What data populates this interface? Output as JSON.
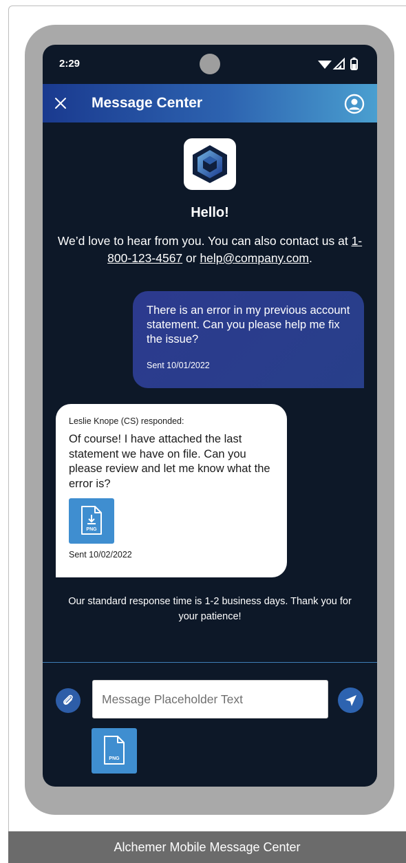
{
  "status_bar": {
    "time": "2:29",
    "icons": [
      "wifi-icon",
      "signal-icon",
      "battery-icon"
    ]
  },
  "header": {
    "title": "Message Center",
    "close_icon": "close-icon",
    "profile_icon": "profile-icon"
  },
  "welcome": {
    "title": "Hello!",
    "intro_prefix": "We’d love to hear from you. You can also contact us at ",
    "phone": "1-800-123-4567",
    "intro_middle": " or ",
    "email": "help@company.com",
    "intro_suffix": "."
  },
  "messages": [
    {
      "direction": "outgoing",
      "text": "There is an error in my previous account statement. Can you please help me fix the issue?",
      "sent": "Sent 10/01/2022"
    },
    {
      "direction": "incoming",
      "author": "Leslie Knope (CS) responded:",
      "text": "Of course! I have attached the last statement we have on file. Can you please review and let me know what the error is?",
      "attachment_type": "PNG",
      "sent": "Sent 10/02/2022"
    }
  ],
  "response_note": "Our standard response time is 1-2 business days. Thank you for your patience!",
  "composer": {
    "placeholder": "Message Placeholder Text",
    "attach_icon": "paperclip-icon",
    "send_icon": "send-icon",
    "pending_attachment_type": "PNG"
  },
  "caption": "Alchemer Mobile Message Center",
  "colors": {
    "screen_background": "#0d1828",
    "header_gradient_start": "#1a3a8f",
    "header_gradient_end": "#4a9fd0",
    "outgoing_bubble": "#2c3a8e",
    "incoming_bubble": "#ffffff",
    "attachment_tile": "#3f8ed0",
    "caption_bar": "#6b6b6b"
  }
}
